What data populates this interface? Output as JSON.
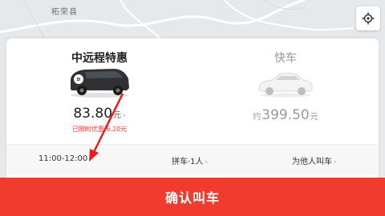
{
  "map": {
    "place_label": "柘荣县"
  },
  "options": [
    {
      "title": "中远程特惠",
      "price": "83.80",
      "unit": "元",
      "discount_note": "已限时优惠 6.20元"
    },
    {
      "title": "快车",
      "price_prefix": "约",
      "price": "399.50",
      "unit": "元"
    }
  ],
  "bar": {
    "time": "11:00-12:00",
    "carpool": "拼车·1人",
    "for_others": "为他人叫车"
  },
  "confirm_label": "确认叫车",
  "colors": {
    "accent": "#f03c2e",
    "discount": "#ff3b30",
    "annotation": "#e81f1f"
  }
}
